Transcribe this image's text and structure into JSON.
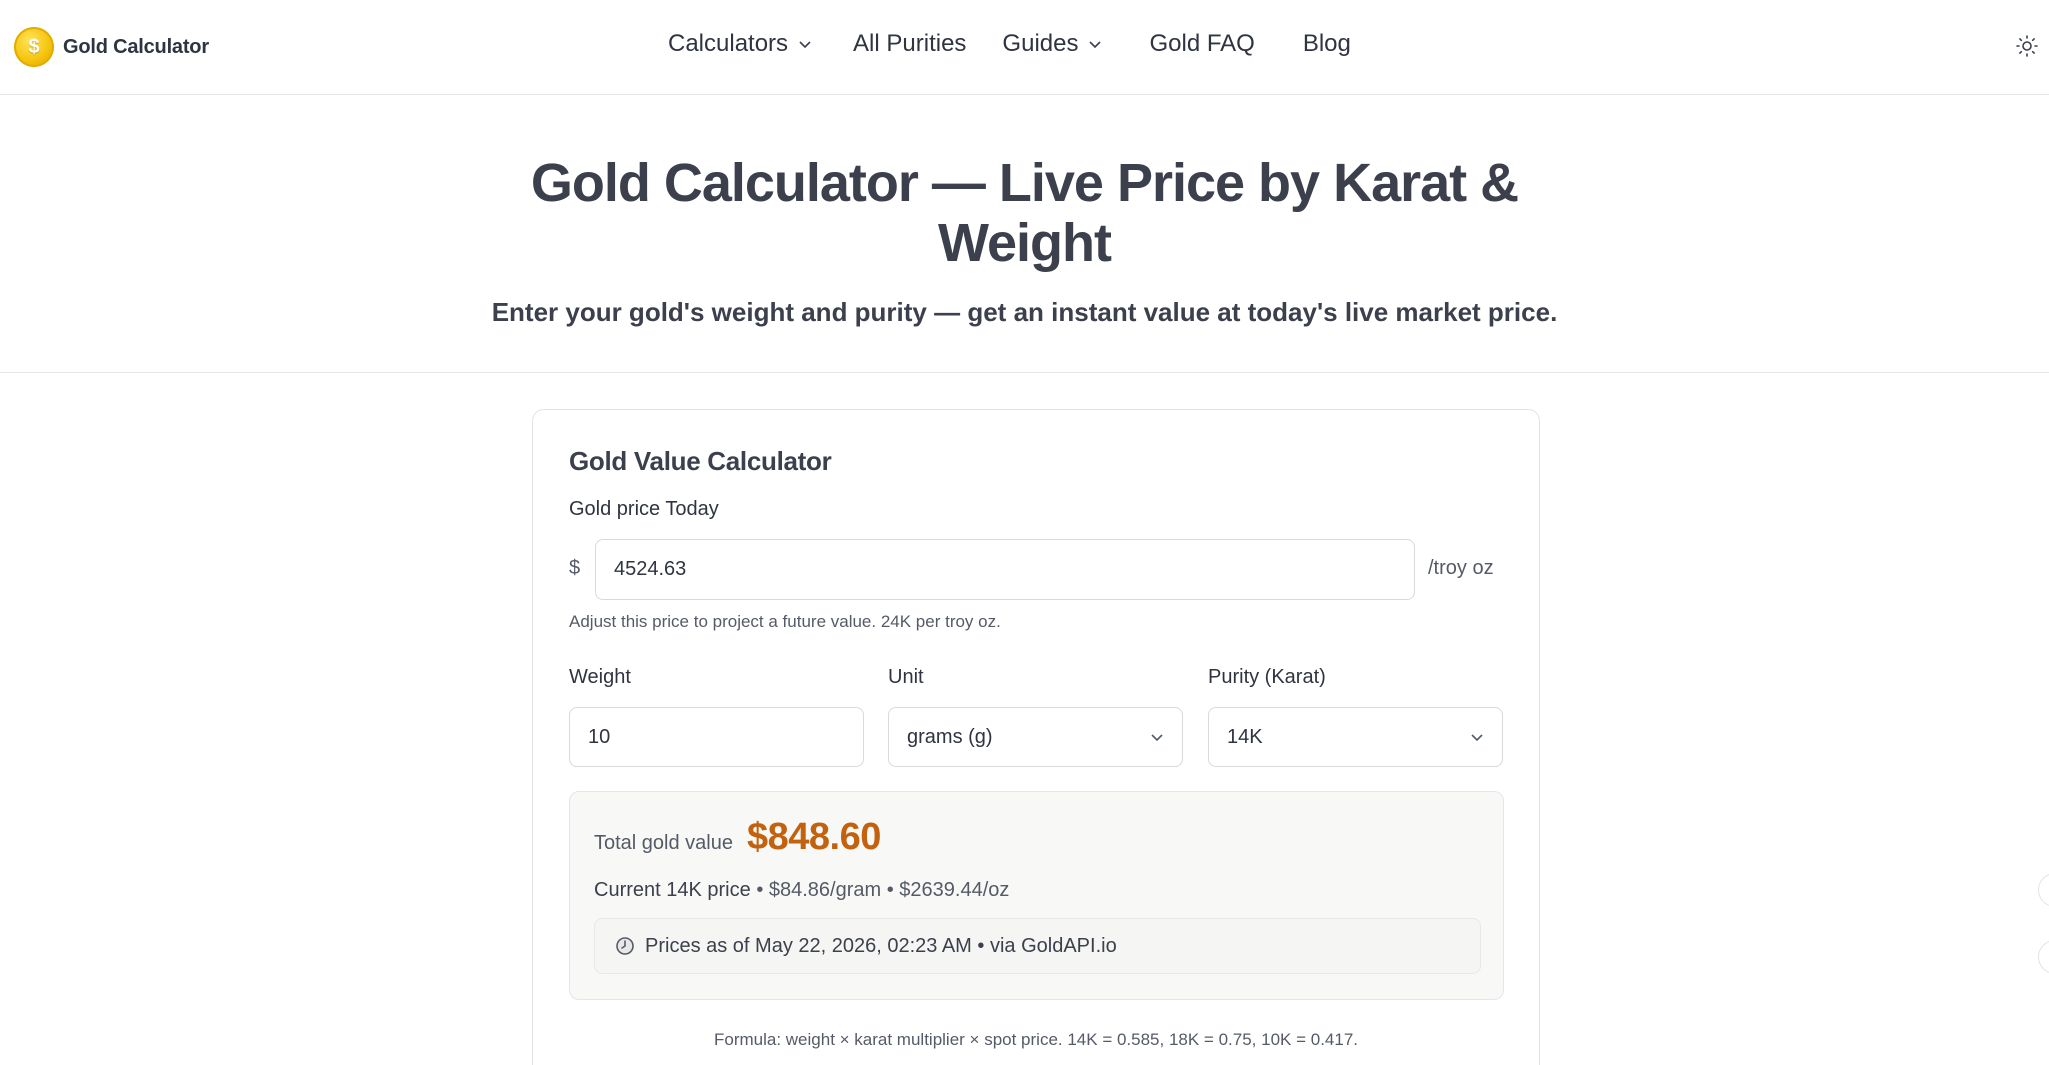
{
  "header": {
    "brand_name": "Gold Calculator",
    "brand_symbol": "$",
    "nav": [
      {
        "label": "Calculators",
        "has_dropdown": true
      },
      {
        "label": "All Purities",
        "has_dropdown": false
      },
      {
        "label": "Guides",
        "has_dropdown": true
      },
      {
        "label": "Gold FAQ",
        "has_dropdown": false
      },
      {
        "label": "Blog",
        "has_dropdown": false
      }
    ],
    "theme_icon": "sun-icon"
  },
  "hero": {
    "title": "Gold Calculator — Live Price by Karat & Weight",
    "subtitle": "Enter your gold's weight and purity — get an instant value at today's live market price."
  },
  "calculator": {
    "title": "Gold Value Calculator",
    "price_label": "Gold price Today",
    "currency_symbol": "$",
    "price_value": "4524.63",
    "price_unit": "/troy oz",
    "price_hint": "Adjust this price to project a future value. 24K per troy oz.",
    "weight_label": "Weight",
    "weight_value": "10",
    "unit_label": "Unit",
    "unit_value": "grams (g)",
    "purity_label": "Purity (Karat)",
    "purity_value": "14K",
    "result": {
      "total_label": "Total gold value",
      "total_value": "$848.60",
      "rate_label": "Current 14K price",
      "rate_detail": "• $84.86/gram • $2639.44/oz",
      "source_text": "Prices as of May 22, 2026, 02:23 AM • via GoldAPI.io",
      "source_icon": "clock-icon"
    },
    "formula": "Formula: weight × karat multiplier × spot price. 14K = 0.585, 18K = 0.75, 10K = 0.417."
  },
  "colors": {
    "accent": "#c2610e",
    "coin": "#f5c40d",
    "text": "#3b404c"
  }
}
